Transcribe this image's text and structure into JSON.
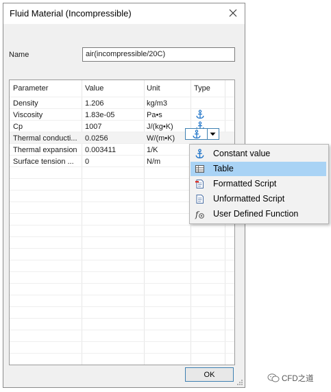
{
  "window": {
    "title": "Fluid Material (Incompressible)"
  },
  "name_field": {
    "label": "Name",
    "value": "air(incompressible/20C)"
  },
  "table": {
    "headers": [
      "Parameter",
      "Value",
      "Unit",
      "Type"
    ],
    "rows": [
      {
        "parameter": "Density",
        "value": "1.206",
        "unit": "kg/m3",
        "type_icon": ""
      },
      {
        "parameter": "Viscosity",
        "value": "1.83e-05",
        "unit": "Pa•s",
        "type_icon": "anchor-icon"
      },
      {
        "parameter": "Cp",
        "value": "1007",
        "unit": "J/(kg•K)",
        "type_icon": "anchor-icon"
      },
      {
        "parameter": "Thermal conducti...",
        "value": "0.0256",
        "unit": "W/(m•K)",
        "type_icon": "anchor-icon"
      },
      {
        "parameter": "Thermal expansion",
        "value": "0.003411",
        "unit": "1/K",
        "type_icon": "anchor-icon"
      },
      {
        "parameter": "Surface tension ...",
        "value": "0",
        "unit": "N/m",
        "type_icon": ""
      }
    ]
  },
  "type_dropdown": {
    "options": [
      {
        "label": "Constant value",
        "icon": "anchor-icon"
      },
      {
        "label": "Table",
        "icon": "table-icon"
      },
      {
        "label": "Formatted Script",
        "icon": "formatted-script-icon"
      },
      {
        "label": "Unformatted Script",
        "icon": "document-icon"
      },
      {
        "label": "User Defined Function",
        "icon": "function-icon"
      }
    ],
    "highlighted": "Table"
  },
  "buttons": {
    "ok": "OK"
  },
  "watermark": {
    "text": "CFD之道"
  },
  "colors": {
    "accent": "#3c7fb1",
    "selection": "#a9d3f5",
    "icon_blue": "#1e73c8"
  }
}
